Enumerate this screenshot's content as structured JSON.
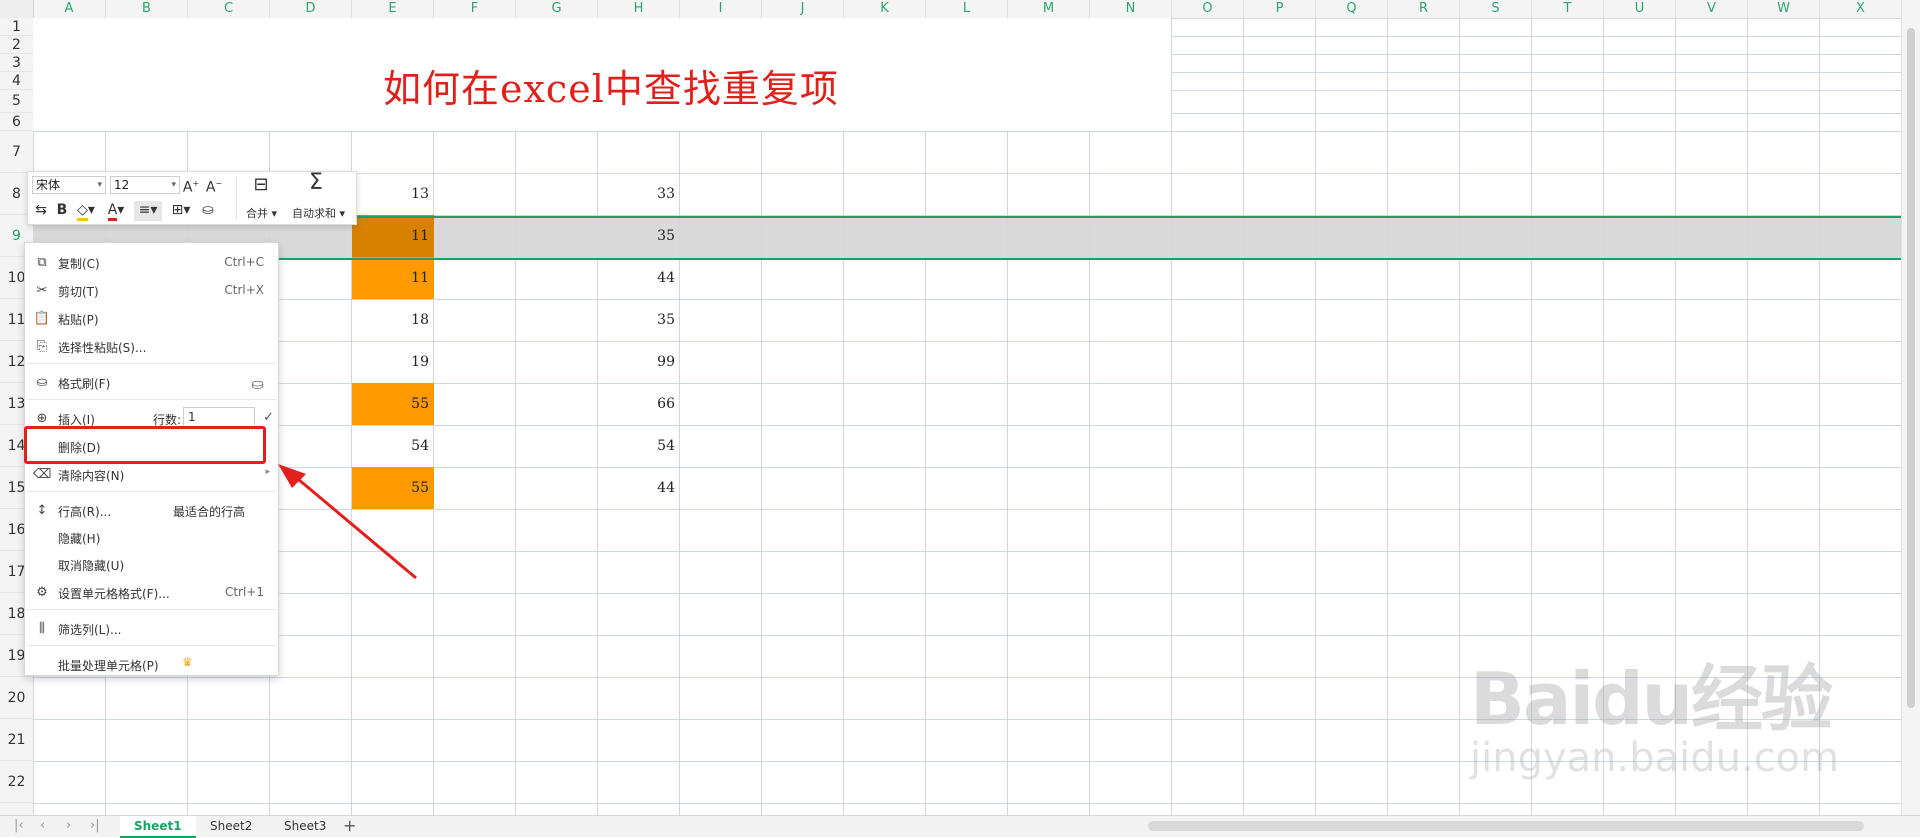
{
  "sheet": {
    "columns": [
      "A",
      "B",
      "C",
      "D",
      "E",
      "F",
      "G",
      "H",
      "I",
      "J",
      "K",
      "L",
      "M",
      "N",
      "O",
      "P",
      "Q",
      "R",
      "S",
      "T",
      "U",
      "V",
      "W",
      "X"
    ],
    "rows": [
      "1",
      "2",
      "3",
      "4",
      "5",
      "6",
      "7",
      "8",
      "9",
      "10",
      "11",
      "12",
      "13",
      "14",
      "15",
      "16",
      "17",
      "18",
      "19",
      "20",
      "21",
      "22"
    ],
    "title": "如何在excel中查找重复项",
    "col_e": [
      "13",
      "11",
      "11",
      "18",
      "19",
      "55",
      "54",
      "55"
    ],
    "col_h": [
      "33",
      "35",
      "44",
      "35",
      "99",
      "66",
      "54",
      "44"
    ],
    "selected_row": "9",
    "colors": {
      "highlight": "#ff9900",
      "highlight_selected": "#d88000",
      "accent": "#1aa261",
      "title": "#e0201b"
    }
  },
  "mini_toolbar": {
    "font_name": "宋体",
    "font_size": "12",
    "merge_label": "合并",
    "autosum_label": "自动求和",
    "icons": [
      "grow-font-icon",
      "shrink-font-icon",
      "merge-cells-icon",
      "sigma-icon",
      "wrap-icon",
      "bold-icon",
      "fill-color-icon",
      "font-color-icon",
      "align-icon",
      "border-icon",
      "format-brush-icon"
    ]
  },
  "context_menu": {
    "items": [
      {
        "label": "复制(C)",
        "shortcut": "Ctrl+C",
        "icon": "copy-icon"
      },
      {
        "label": "剪切(T)",
        "shortcut": "Ctrl+X",
        "icon": "scissors-icon"
      },
      {
        "label": "粘贴(P)",
        "shortcut": "",
        "icon": "paste-icon"
      },
      {
        "label": "选择性粘贴(S)...",
        "shortcut": "",
        "icon": "paste-special-icon"
      },
      {
        "label": "格式刷(F)",
        "shortcut": "",
        "icon": "brush-icon"
      },
      {
        "label": "插入(I)",
        "shortcut": "",
        "icon": "insert-icon"
      },
      {
        "label": "删除(D)",
        "shortcut": "",
        "icon": ""
      },
      {
        "label": "清除内容(N)",
        "shortcut": "",
        "icon": "clear-icon"
      },
      {
        "label": "行高(R)...",
        "shortcut": "",
        "icon": "row-height-icon"
      },
      {
        "label": "隐藏(H)",
        "shortcut": "",
        "icon": ""
      },
      {
        "label": "取消隐藏(U)",
        "shortcut": "",
        "icon": ""
      },
      {
        "label": "设置单元格格式(F)...",
        "shortcut": "Ctrl+1",
        "icon": "format-cells-icon"
      },
      {
        "label": "筛选列(L)...",
        "shortcut": "",
        "icon": "filter-icon"
      },
      {
        "label": "批量处理单元格(P)",
        "shortcut": "",
        "icon": "batch-icon"
      }
    ],
    "rows_label": "行数:",
    "rows_value": "1",
    "best_fit_label": "最适合的行高"
  },
  "sheet_tabs": [
    "Sheet1",
    "Sheet2",
    "Sheet3"
  ],
  "active_tab": "Sheet1",
  "add_sheet": "+",
  "watermark": {
    "logo": "Baidu经验",
    "url": "jingyan.baidu.com"
  }
}
